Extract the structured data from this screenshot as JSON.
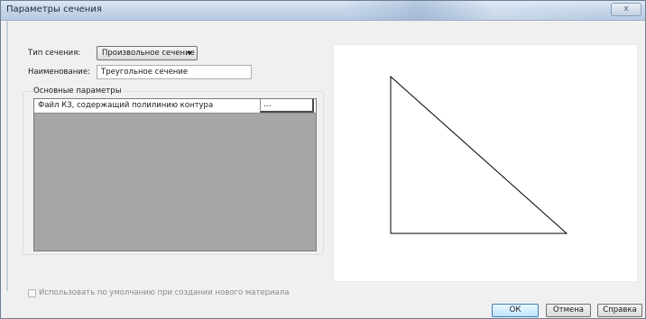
{
  "window": {
    "title": "Параметры сечения",
    "close_label": "x"
  },
  "form": {
    "section_type_label": "Тип сечения:",
    "section_type_value": "Произвольное сечение",
    "name_label": "Наименование:",
    "name_value": "Треугольное сечение"
  },
  "parameters": {
    "group_label": "Основные параметры",
    "rows": [
      {
        "name": "Файл КЗ, содержащий полилинию контура",
        "value": "..."
      }
    ]
  },
  "preview": {
    "shape": "right-triangle",
    "stroke_color": "#000000"
  },
  "options": {
    "default_checkbox_label": "Использовать по умолчанию при создании нового материала",
    "default_checkbox_checked": false,
    "default_checkbox_enabled": false
  },
  "buttons": {
    "ok": "ОК",
    "cancel": "Отмена",
    "help": "Справка"
  },
  "colors": {
    "grid_background": "#a6a6a6",
    "ok_accent": "#3c7fb1"
  }
}
